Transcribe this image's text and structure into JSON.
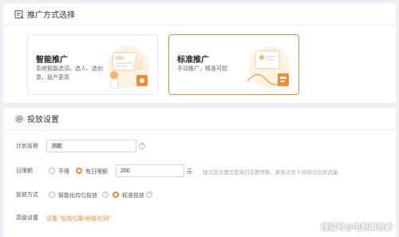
{
  "promo_section": {
    "title": "推广方式选择",
    "options": [
      {
        "title": "智能推广",
        "desc_line1": "系统智能选词、选人、选创",
        "desc_line2": "意，投产更高",
        "selected": false
      },
      {
        "title": "标准推广",
        "desc_line1": "手动推广，精准可控",
        "desc_line2": "",
        "selected": true
      }
    ]
  },
  "delivery_section": {
    "title": "投放设置",
    "plan_name": {
      "label": "计划名称",
      "value": "测款"
    },
    "daily_budget": {
      "label": "日限额",
      "opt_unlimited": "不限",
      "opt_limited": "有日限额",
      "value": "200",
      "unit": "元",
      "hint": "建议您合理设置每日花费预算，避免过早下线错过优质流量。",
      "selected": "limited"
    },
    "delivery_method": {
      "label": "投放方式",
      "opt_smart": "智能化均匀投放",
      "opt_standard": "标准投放",
      "selected": "standard"
    },
    "advanced": {
      "label": "高级设置",
      "link": "设置 \"投放位置/地域/时间\""
    }
  },
  "watermark": "搜狐号@电商南治者",
  "colors": {
    "accent": "#f08c2c",
    "background": "#edf0f3"
  }
}
